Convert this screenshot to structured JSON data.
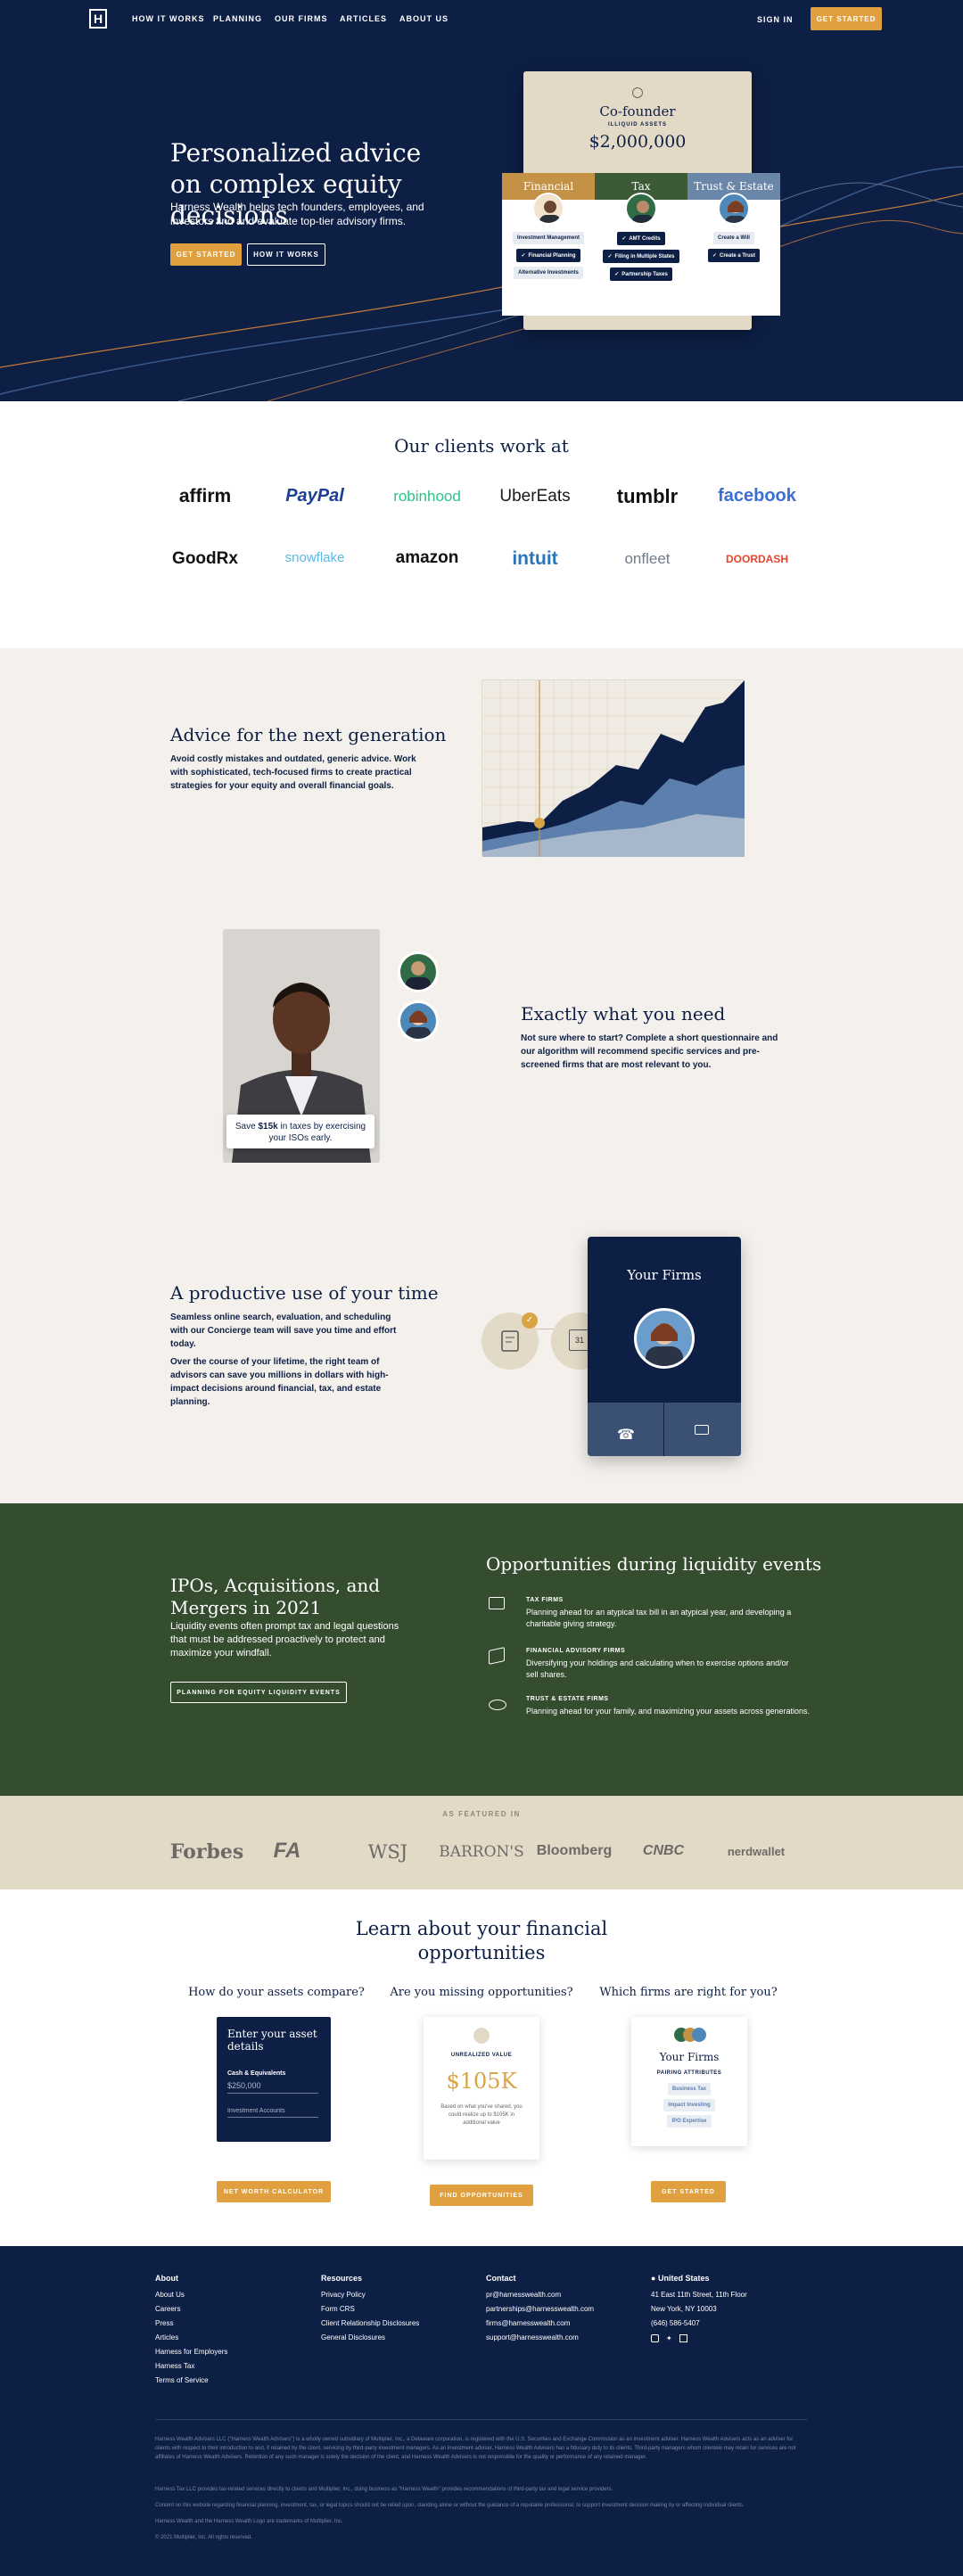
{
  "nav": {
    "logo": "H",
    "links": [
      "HOW IT WORKS",
      "PLANNING",
      "OUR FIRMS",
      "ARTICLES",
      "ABOUT US"
    ],
    "sign_in": "SIGN IN",
    "cta": "GET STARTED"
  },
  "hero": {
    "title": "Personalized advice on complex equity decisions",
    "subtitle": "Harness Wealth helps tech founders, employees, and investors find and evaluate top-tier advisory firms.",
    "cta_primary": "GET STARTED",
    "cta_secondary": "HOW IT WORKS",
    "card": {
      "role": "Co-founder",
      "assets_label": "ILLIQUID ASSETS",
      "assets_value": "$2,000,000",
      "columns": [
        {
          "title": "Financial",
          "items": [
            {
              "label": "Investment Management",
              "checked": false
            },
            {
              "label": "Financial Planning",
              "checked": true
            },
            {
              "label": "Alternative Investments",
              "checked": false
            }
          ]
        },
        {
          "title": "Tax",
          "items": [
            {
              "label": "AMT Credits",
              "checked": true
            },
            {
              "label": "Filing in Multiple States",
              "checked": true
            },
            {
              "label": "Partnership Taxes",
              "checked": true
            }
          ]
        },
        {
          "title": "Trust & Estate",
          "items": [
            {
              "label": "Create a Will",
              "checked": false
            },
            {
              "label": "Create a Trust",
              "checked": true
            }
          ]
        }
      ]
    }
  },
  "clients": {
    "title": "Our clients work at",
    "logos": [
      "affirm",
      "PayPal",
      "robinhood",
      "UberEats",
      "tumblr",
      "facebook",
      "GoodRx",
      "snowflake",
      "amazon",
      "intuit",
      "onfleet",
      "DOORDASH"
    ]
  },
  "advice": {
    "title": "Advice for the next generation",
    "body": "Avoid costly mistakes and outdated, generic advice. Work with sophisticated, tech-focused firms to create practical strategies for your equity and overall financial goals."
  },
  "need": {
    "title": "Exactly what you need",
    "body": "Not sure where to start? Complete a short questionnaire and our algorithm will recommend specific services and pre-screened firms that are most relevant to you.",
    "savings_prefix": "Save ",
    "savings_amount": "$15k",
    "savings_suffix": " in taxes by exercising your ISOs early."
  },
  "time": {
    "title": "A productive use of your time",
    "body1": "Seamless online search, evaluation, and scheduling with our Concierge team will save you time and effort today.",
    "body2": "Over the course of your lifetime, the right team of advisors can save you millions in dollars with high-impact decisions around financial, tax, and estate planning.",
    "phone_title": "Your Firms",
    "calendar_day": "31"
  },
  "liquidity": {
    "title": "IPOs, Acquisitions, and Mergers in 2021",
    "body": "Liquidity events often prompt tax and legal questions that must be addressed proactively to protect and maximize your windfall.",
    "cta": "PLANNING FOR EQUITY LIQUIDITY EVENTS",
    "right_title": "Opportunities during liquidity events",
    "items": [
      {
        "title": "TAX FIRMS",
        "body": "Planning ahead for an atypical tax bill in an atypical year, and developing a charitable giving strategy."
      },
      {
        "title": "FINANCIAL ADVISORY FIRMS",
        "body": "Diversifying your holdings and calculating when to exercise options and/or sell shares."
      },
      {
        "title": "TRUST & ESTATE FIRMS",
        "body": "Planning ahead for your family, and maximizing your assets across generations."
      }
    ]
  },
  "featured": {
    "label": "AS FEATURED IN",
    "logos": [
      "Forbes",
      "FA",
      "WSJ",
      "BARRON'S",
      "Bloomberg",
      "CNBC",
      "nerdwallet"
    ]
  },
  "learn": {
    "title": "Learn about your financial opportunities",
    "cards": [
      {
        "heading": "How do your assets compare?",
        "inner_title": "Enter your asset details",
        "field1_label": "Cash & Equivalents",
        "field1_value": "$250,000",
        "field2_label": "Investment Accounts",
        "cta": "NET WORTH CALCULATOR"
      },
      {
        "heading": "Are you missing opportunities?",
        "inner_label": "UNREALIZED VALUE",
        "inner_value": "$105K",
        "inner_note": "Based on what you've shared, you could realize up to $105K in additional value",
        "cta": "FIND OPPORTUNITIES"
      },
      {
        "heading": "Which firms are right for you?",
        "inner_title": "Your Firms",
        "inner_label": "PAIRING ATTRIBUTES",
        "tags": [
          "Business Tax",
          "Impact Investing",
          "IPO Expertise"
        ],
        "cta": "GET STARTED"
      }
    ]
  },
  "footer": {
    "about": {
      "title": "About",
      "items": [
        "About Us",
        "Careers",
        "Press",
        "Articles",
        "Harness for Employers",
        "Harness Tax",
        "Terms of Service"
      ]
    },
    "resources": {
      "title": "Resources",
      "items": [
        "Privacy Policy",
        "Form CRS",
        "Client Relationship Disclosures",
        "General Disclosures"
      ]
    },
    "contact": {
      "title": "Contact",
      "items": [
        "pr@harnesswealth.com",
        "partnerships@harnesswealth.com",
        "firms@harnesswealth.com",
        "support@harnesswealth.com"
      ]
    },
    "location": {
      "title": "United States",
      "items": [
        "41 East 11th Street, 11th Floor",
        "New York, NY 10003",
        "(646) 586-5407"
      ]
    },
    "fine1": "Harness Wealth Advisers LLC (\"Harness Wealth Advisers\") is a wholly owned subsidiary of Multiplier, Inc., a Delaware corporation, is registered with the U.S. Securities and Exchange Commission as an investment adviser. Harness Wealth Advisers acts as an adviser for clients with respect to their introduction to and, if retained by the client, servicing by third-party investment managers. As an investment adviser, Harness Wealth Advisers has a fiduciary duty to its clients. Third-party managers whom clientele may retain for services are not affiliates of Harness Wealth Advisers. Retention of any such manager is solely the decision of the client, and Harness Wealth Advisers is not responsible for the quality or performance of any retained manager.",
    "fine2": "Harness Tax LLC provides tax-related services directly to clients and Multiplier, Inc., doing business as \"Harness Wealth\" provides recommendations of third-party tax and legal service providers.",
    "fine3": "Content on this website regarding financial planning, investment, tax, or legal topics should not be relied upon, standing alone or without the guidance of a reputable professional, to support investment decision making by or affecting individual clients.",
    "fine4": "Harness Wealth and the Harness Wealth Logo are trademarks of Multiplier, Inc.",
    "copyright": "© 2021 Multiplier, Inc. All rights reserved."
  },
  "colors": {
    "navy": "#0d1f45",
    "gold": "#e0a03f",
    "forest": "#354d2f",
    "sand": "#e3d9c7"
  }
}
